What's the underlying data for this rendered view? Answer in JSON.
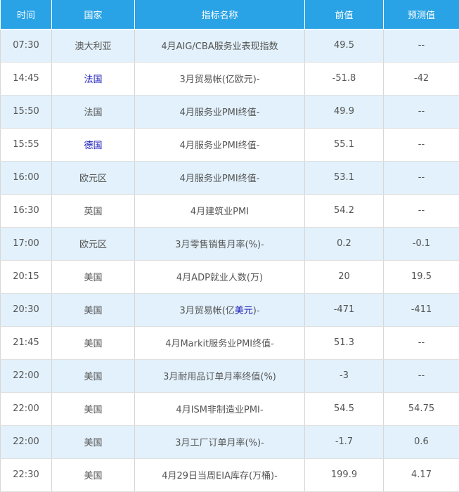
{
  "headers": {
    "time": "时间",
    "country": "国家",
    "indicator": "指标名称",
    "previous": "前值",
    "forecast": "预测值"
  },
  "rows": [
    {
      "time": "07:30",
      "country": "澳大利亚",
      "country_link": false,
      "indicator": "4月AIG/CBA服务业表现指数",
      "previous": "49.5",
      "forecast": "--"
    },
    {
      "time": "14:45",
      "country": "法国",
      "country_link": true,
      "indicator": "3月贸易帐(亿欧元)-",
      "previous": "-51.8",
      "forecast": "-42"
    },
    {
      "time": "15:50",
      "country": "法国",
      "country_link": false,
      "indicator": "4月服务业PMI终值-",
      "previous": "49.9",
      "forecast": "--"
    },
    {
      "time": "15:55",
      "country": "德国",
      "country_link": true,
      "indicator": "4月服务业PMI终值-",
      "previous": "55.1",
      "forecast": "--"
    },
    {
      "time": "16:00",
      "country": "欧元区",
      "country_link": false,
      "indicator": "4月服务业PMI终值-",
      "previous": "53.1",
      "forecast": "--"
    },
    {
      "time": "16:30",
      "country": "英国",
      "country_link": false,
      "indicator": "4月建筑业PMI",
      "previous": "54.2",
      "forecast": "--"
    },
    {
      "time": "17:00",
      "country": "欧元区",
      "country_link": false,
      "indicator": "3月零售销售月率(%)-",
      "previous": "0.2",
      "forecast": "-0.1"
    },
    {
      "time": "20:15",
      "country": "美国",
      "country_link": false,
      "indicator": "4月ADP就业人数(万)",
      "previous": "20",
      "forecast": "19.5"
    },
    {
      "time": "20:30",
      "country": "美国",
      "country_link": false,
      "indicator": "3月贸易帐(亿美元)-",
      "indicator_pre": "3月贸易帐(亿",
      "indicator_hl": "美元",
      "indicator_post": ")-",
      "previous": "-471",
      "forecast": "-411"
    },
    {
      "time": "21:45",
      "country": "美国",
      "country_link": false,
      "indicator": "4月Markit服务业PMI终值-",
      "previous": "51.3",
      "forecast": "--"
    },
    {
      "time": "22:00",
      "country": "美国",
      "country_link": false,
      "indicator": "3月耐用品订单月率终值(%)",
      "previous": "-3",
      "forecast": "--"
    },
    {
      "time": "22:00",
      "country": "美国",
      "country_link": false,
      "indicator": "4月ISM非制造业PMI-",
      "previous": "54.5",
      "forecast": "54.75"
    },
    {
      "time": "22:00",
      "country": "美国",
      "country_link": false,
      "indicator": "3月工厂订单月率(%)-",
      "previous": "-1.7",
      "forecast": "0.6"
    },
    {
      "time": "22:30",
      "country": "美国",
      "country_link": false,
      "indicator": "4月29日当周EIA库存(万桶)-",
      "previous": "199.9",
      "forecast": "4.17"
    }
  ],
  "colors": {
    "header_bg": "#29a3e6",
    "row_alt_bg": "#e2f1fb",
    "link": "#1a1ab8",
    "text": "#555555"
  }
}
